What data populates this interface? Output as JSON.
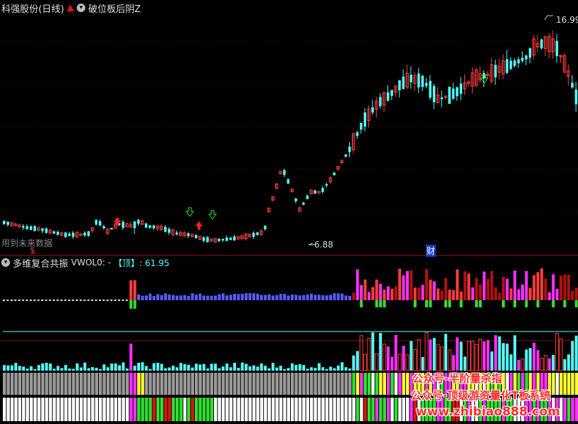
{
  "header": {
    "stock_name": "科强股份(日线)",
    "indicator_name": "破位板后阴Z"
  },
  "price_labels": {
    "high_price": "16.99",
    "low_price": "6.88",
    "future_data_note": "用到未来数据",
    "dollar_marker": "$",
    "finance_marker": "财"
  },
  "sub_header": {
    "indicator_title": "多维复合共振",
    "vwol_label": "VWOL0: -",
    "top_label": "【顶】: 61.95"
  },
  "watermark": {
    "line1": "公众号-半阶量杀指",
    "line2": "公众号-顶级游资量化T板系统",
    "line3": "www.zhibiao888.com"
  },
  "colors": {
    "up": "#ff3c3c",
    "down": "#54ffff",
    "grid": "#7a0000",
    "magenta": "#ff30ff",
    "blue": "#5a5aff",
    "green": "#30e030",
    "yellow": "#ffff30",
    "gray": "#9a9a9a",
    "darkred": "#b01010"
  }
}
